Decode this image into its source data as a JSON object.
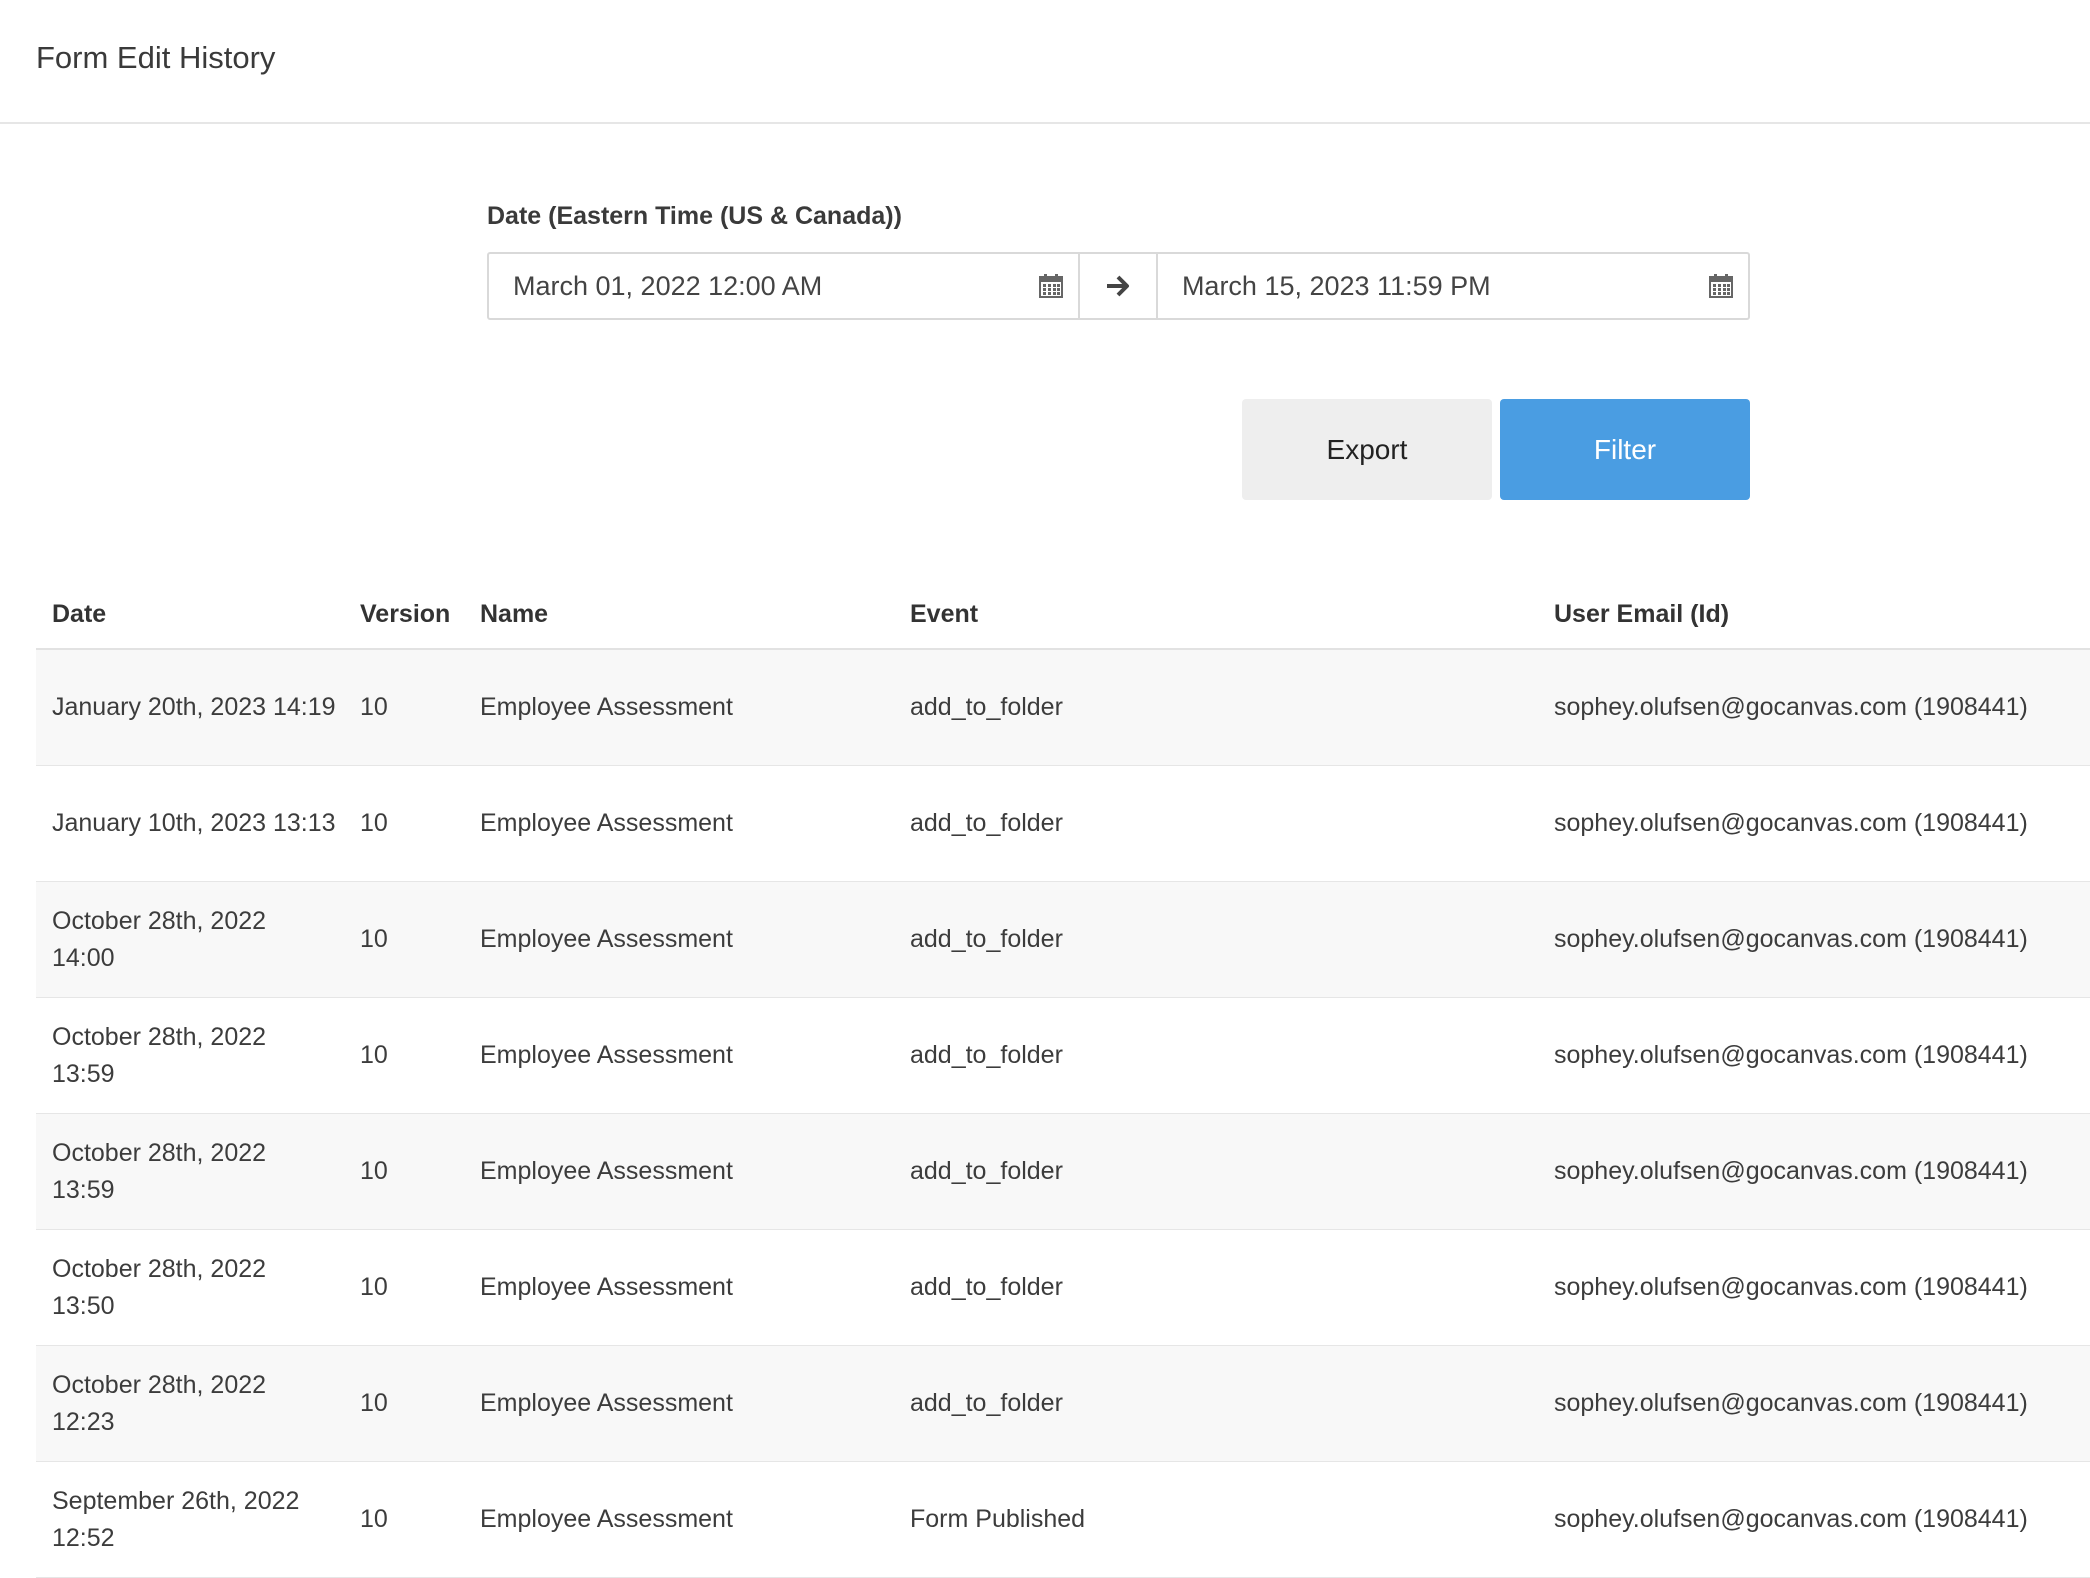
{
  "header": {
    "title": "Form Edit History"
  },
  "filters": {
    "date_label": "Date (Eastern Time (US & Canada))",
    "start_value": "March 01, 2022 12:00 AM",
    "end_value": "March 15, 2023 11:59 PM",
    "export_label": "Export",
    "filter_label": "Filter"
  },
  "colors": {
    "filter_button": "#4a9de2",
    "export_button": "#eeeeee",
    "row_stripe": "#f8f8f8"
  },
  "table": {
    "columns": [
      "Date",
      "Version",
      "Name",
      "Event",
      "User Email (Id)"
    ],
    "rows": [
      {
        "date": "January 20th, 2023 14:19",
        "version": "10",
        "name": "Employee Assessment",
        "event": "add_to_folder",
        "email": "sophey.olufsen@gocanvas.com (1908441)"
      },
      {
        "date": "January 10th, 2023 13:13",
        "version": "10",
        "name": "Employee Assessment",
        "event": "add_to_folder",
        "email": "sophey.olufsen@gocanvas.com (1908441)"
      },
      {
        "date": "October 28th, 2022 14:00",
        "version": "10",
        "name": "Employee Assessment",
        "event": "add_to_folder",
        "email": "sophey.olufsen@gocanvas.com (1908441)"
      },
      {
        "date": "October 28th, 2022 13:59",
        "version": "10",
        "name": "Employee Assessment",
        "event": "add_to_folder",
        "email": "sophey.olufsen@gocanvas.com (1908441)"
      },
      {
        "date": "October 28th, 2022 13:59",
        "version": "10",
        "name": "Employee Assessment",
        "event": "add_to_folder",
        "email": "sophey.olufsen@gocanvas.com (1908441)"
      },
      {
        "date": "October 28th, 2022 13:50",
        "version": "10",
        "name": "Employee Assessment",
        "event": "add_to_folder",
        "email": "sophey.olufsen@gocanvas.com (1908441)"
      },
      {
        "date": "October 28th, 2022 12:23",
        "version": "10",
        "name": "Employee Assessment",
        "event": "add_to_folder",
        "email": "sophey.olufsen@gocanvas.com (1908441)"
      },
      {
        "date": "September 26th, 2022 12:52",
        "version": "10",
        "name": "Employee Assessment",
        "event": "Form Published",
        "email": "sophey.olufsen@gocanvas.com (1908441)"
      }
    ]
  }
}
